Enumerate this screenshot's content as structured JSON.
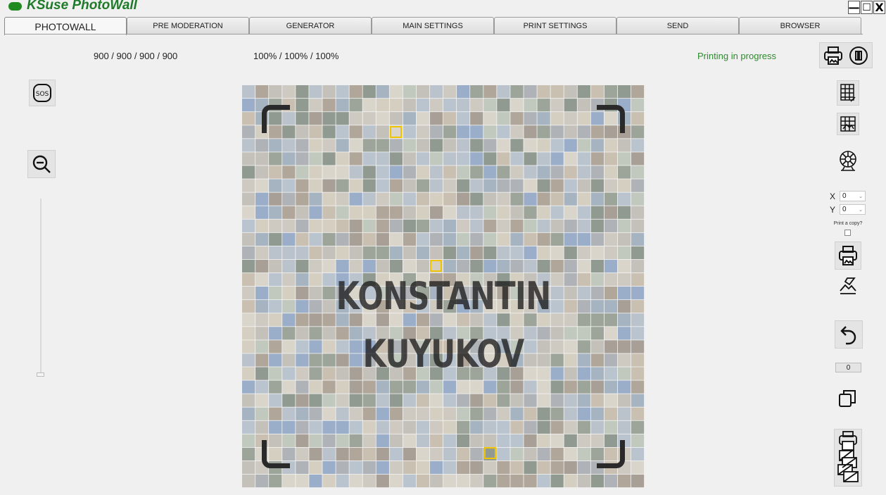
{
  "app": {
    "title": "KSuse PhotoWall",
    "brand_color": "#1f8a1f"
  },
  "window_controls": {
    "minimize": "—",
    "maximize": "☐",
    "close": "X"
  },
  "tabs": [
    {
      "label": "PHOTOWALL",
      "active": true
    },
    {
      "label": "PRE MODERATION"
    },
    {
      "label": "GENERATOR"
    },
    {
      "label": "MAIN SETTINGS"
    },
    {
      "label": "PRINT SETTINGS"
    },
    {
      "label": "SEND"
    },
    {
      "label": "BROWSER"
    }
  ],
  "stats": {
    "counts": "900 / 900 / 900 / 900",
    "percents": "100% / 100% / 100%"
  },
  "status": {
    "text": "Printing in progress",
    "color": "#2e8b2e"
  },
  "mosaic": {
    "line1": "KONSTANTIN",
    "line2": "KUYUKOV"
  },
  "controls": {
    "x_label": "X",
    "x_value": "0",
    "y_label": "Y",
    "y_value": "0",
    "print_copy_label": "Print a copy?",
    "counter_value": "0"
  },
  "icons": {
    "left": [
      "sos-icon",
      "zoom-out-icon"
    ],
    "top_right": [
      "printer-icon",
      "pause-icon"
    ],
    "right": [
      "layout-edit-icon",
      "layout-grid-icon",
      "reel-icon",
      "print-icon",
      "erase-icon",
      "undo-icon",
      "copy-icon",
      "print-queue-icon"
    ]
  }
}
